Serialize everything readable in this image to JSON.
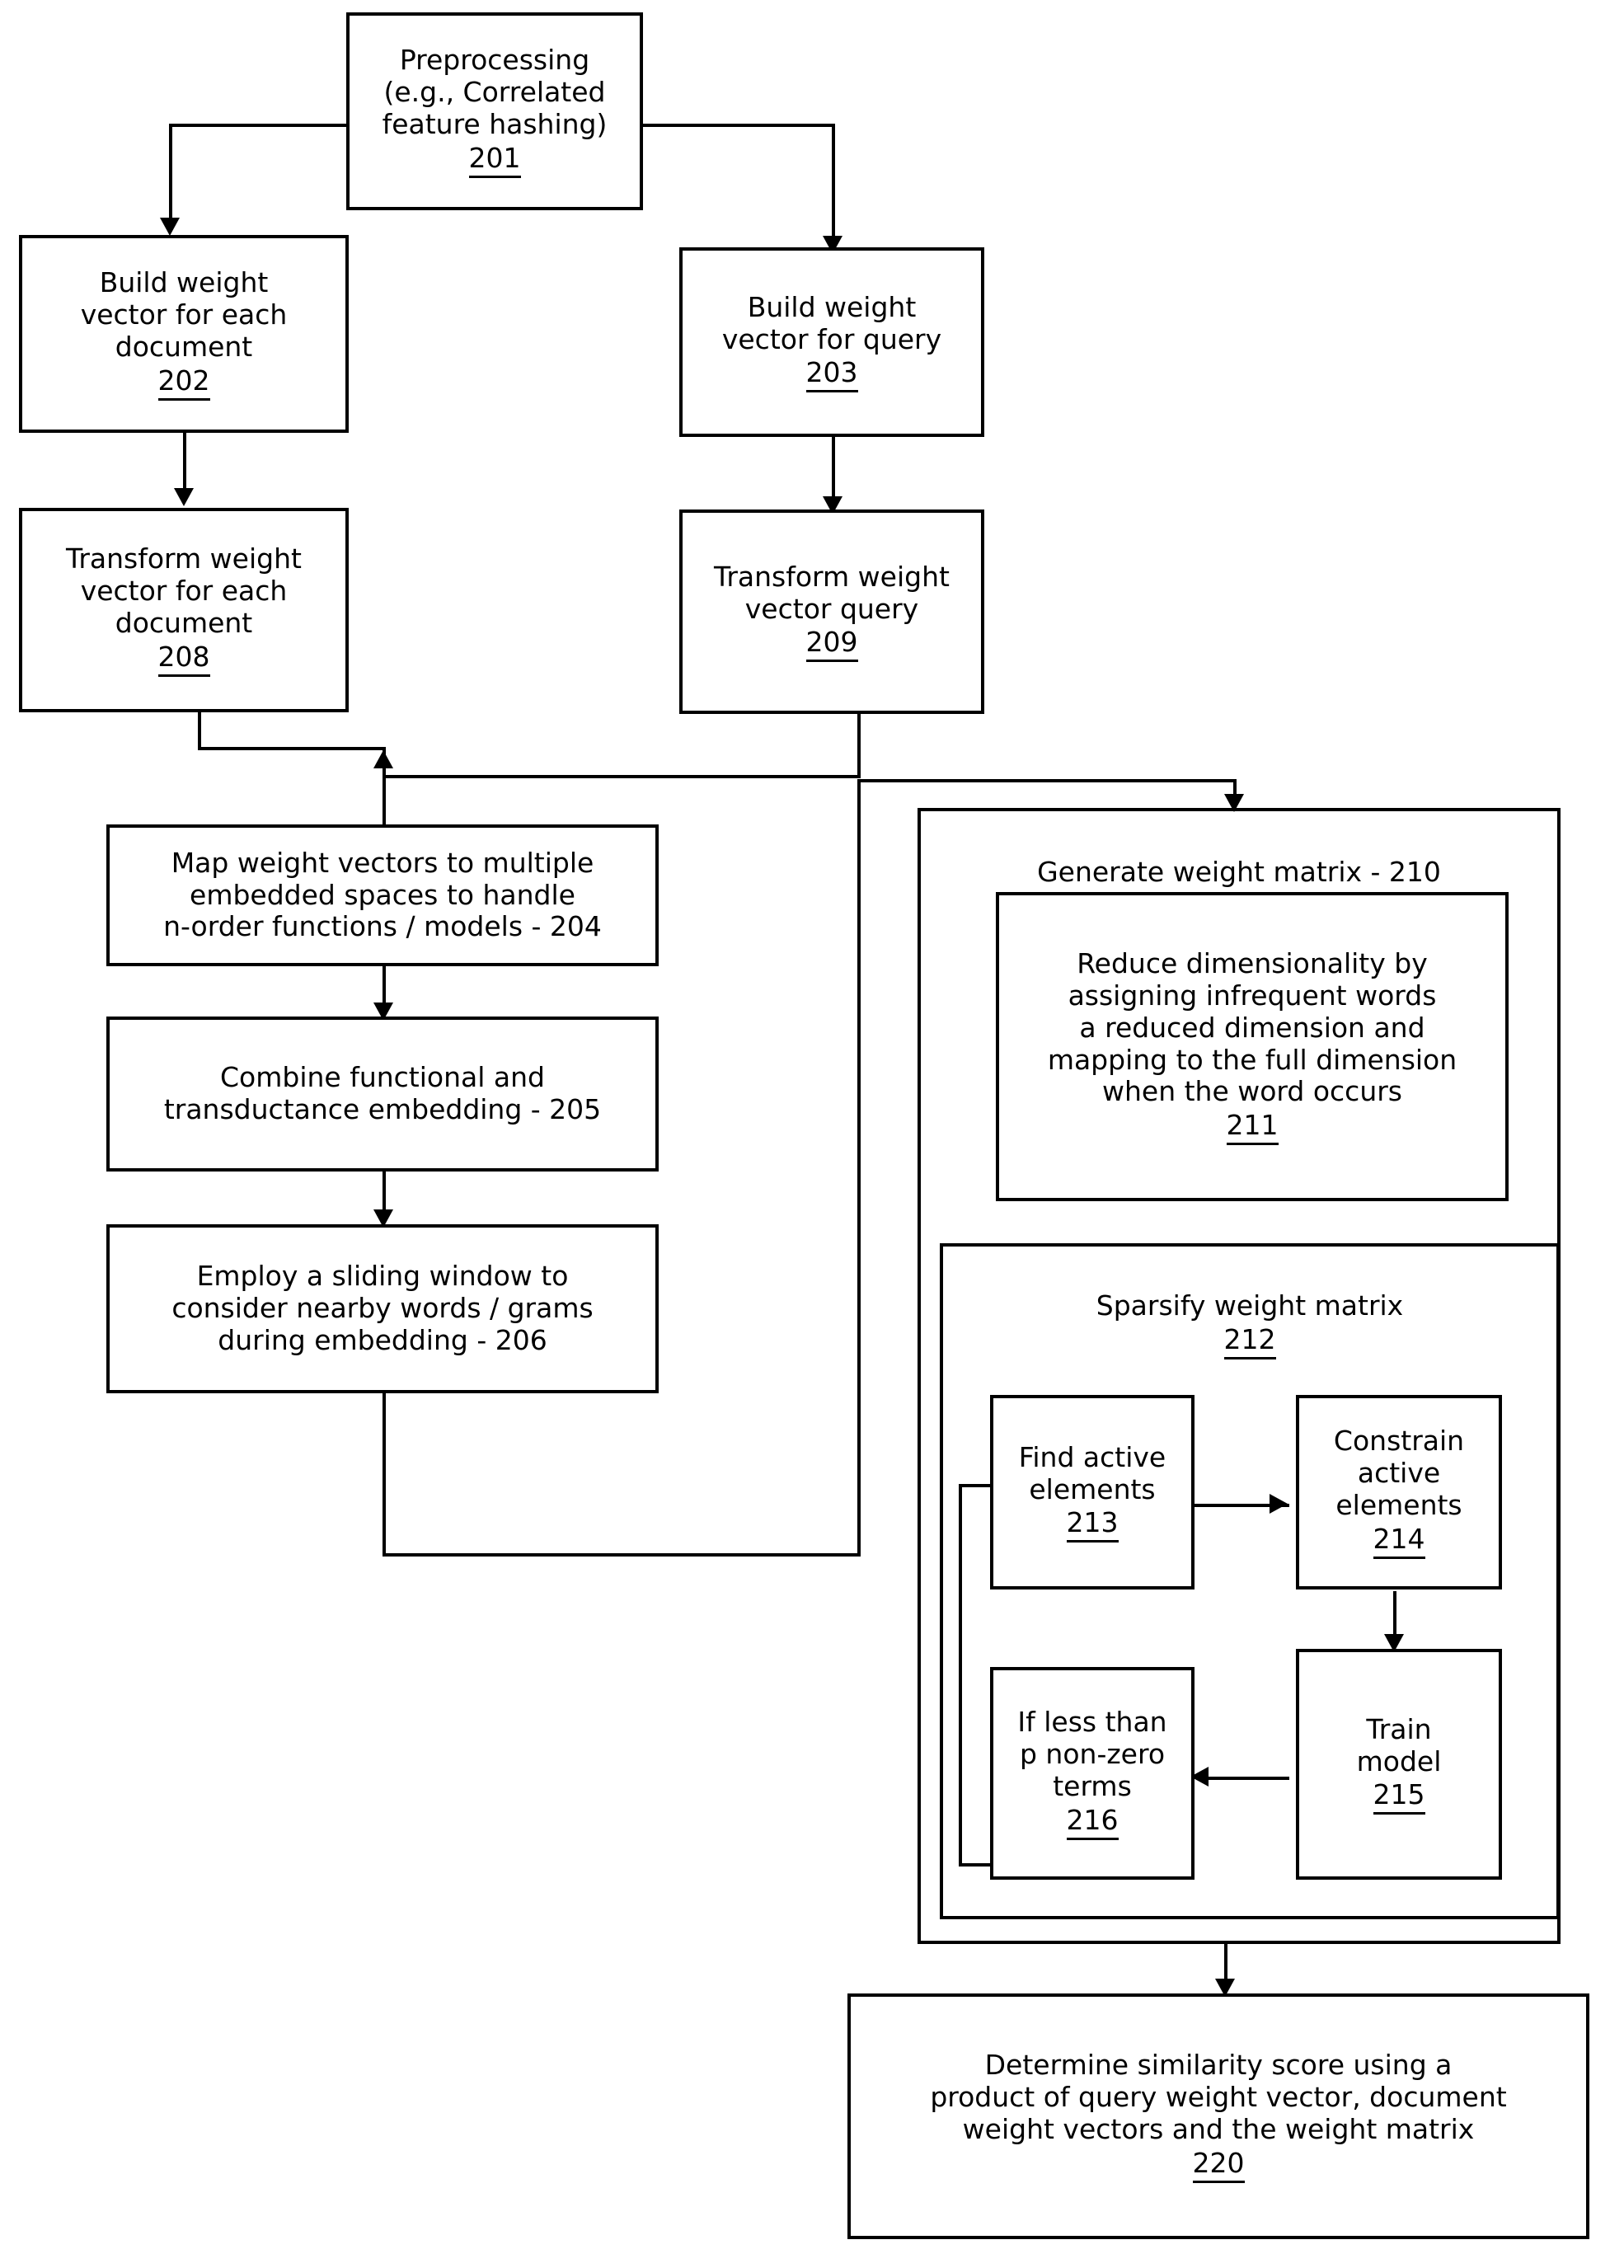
{
  "figure": {
    "type": "patent-flowchart",
    "background": "#ffffff",
    "stroke": "#000000"
  },
  "nodes": {
    "n201": {
      "text": "Preprocessing\n(e.g., Correlated\nfeature hashing)",
      "ref": "201"
    },
    "n202": {
      "text": "Build weight\nvector for each\ndocument",
      "ref": "202"
    },
    "n203": {
      "text": "Build weight\nvector for query",
      "ref": "203"
    },
    "n208": {
      "text": "Transform weight\nvector for each\ndocument",
      "ref": "208"
    },
    "n209": {
      "text": "Transform weight\nvector query",
      "ref": "209"
    },
    "n204": {
      "text": "Map weight vectors to multiple\nembedded spaces to handle\nn-order functions / models - 204",
      "ref": ""
    },
    "n205": {
      "text": "Combine functional and\ntransductance embedding - 205",
      "ref": ""
    },
    "n206": {
      "text": "Employ a sliding window to\nconsider nearby words / grams\nduring embedding - 206",
      "ref": ""
    },
    "n210": {
      "text": "Generate weight matrix - 210",
      "ref": ""
    },
    "n211": {
      "text": "Reduce dimensionality by\nassigning infrequent words\na reduced dimension and\nmapping to the full dimension\nwhen the word occurs",
      "ref": "211"
    },
    "n212": {
      "text": "Sparsify weight matrix",
      "ref": "212"
    },
    "n213": {
      "text": "Find active\nelements",
      "ref": "213"
    },
    "n214": {
      "text": "Constrain\nactive\nelements",
      "ref": "214"
    },
    "n215": {
      "text": "Train\nmodel",
      "ref": "215"
    },
    "n216": {
      "text": "If less than\np non-zero\nterms",
      "ref": "216"
    },
    "n220": {
      "text": "Determine similarity score using a\nproduct of query weight vector, document\nweight vectors and the weight matrix",
      "ref": "220"
    }
  }
}
